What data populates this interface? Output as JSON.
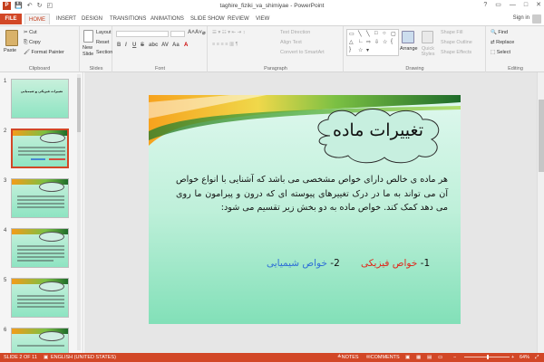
{
  "window": {
    "title": "taghire_fiziki_va_shimiyae - PowerPoint",
    "app_icon_letter": "P"
  },
  "qat": {
    "save": "💾",
    "undo": "↶",
    "redo": "↻",
    "start": "◰"
  },
  "win_controls": {
    "help": "?",
    "restore": "▭",
    "minimize": "—",
    "maximize": "□",
    "close": "✕"
  },
  "tabs": [
    "FILE",
    "HOME",
    "INSERT",
    "DESIGN",
    "TRANSITIONS",
    "ANIMATIONS",
    "SLIDE SHOW",
    "REVIEW",
    "VIEW"
  ],
  "active_tab": "HOME",
  "account": {
    "signin": "Sign in"
  },
  "ribbon": {
    "clipboard": {
      "label": "Clipboard",
      "paste": "Paste",
      "cut": "Cut",
      "copy": "Copy",
      "format_painter": "Format Painter"
    },
    "slides": {
      "label": "Slides",
      "new_slide": "New",
      "new_slide2": "Slide",
      "layout": "Layout",
      "reset": "Reset",
      "section": "Section"
    },
    "font": {
      "label": "Font",
      "bold": "B",
      "italic": "I",
      "underline": "U",
      "strike": "S",
      "shadow": "abc",
      "spacing": "AV",
      "case": "Aa",
      "color": "A",
      "grow": "A˄",
      "shrink": "A˅",
      "clear": "⌀"
    },
    "paragraph": {
      "label": "Paragraph",
      "text_direction": "Text Direction",
      "align_text": "Align Text",
      "convert_smartart": "Convert to SmartArt"
    },
    "drawing": {
      "label": "Drawing",
      "arrange": "Arrange",
      "quick_styles": "Quick Styles",
      "shape_fill": "Shape Fill",
      "shape_outline": "Shape Outline",
      "shape_effects": "Shape Effects"
    },
    "editing": {
      "label": "Editing",
      "find": "Find",
      "replace": "Replace",
      "select": "Select"
    }
  },
  "thumbnails": [
    {
      "num": "1",
      "title": "تغییرات فیزیکی و شیمیایی"
    },
    {
      "num": "2"
    },
    {
      "num": "3"
    },
    {
      "num": "4"
    },
    {
      "num": "5"
    },
    {
      "num": "6"
    }
  ],
  "slide": {
    "title": "تغییرات ماده",
    "body": "هر ماده ی خالص دارای خواص مشخصی می باشد که آشنایی با انواع خواص آن می تواند به ما در درک تغییرهای پیوسته ای که درون و پیرامون ما روی می دهد کمک کند. خواص ماده به دو بخش زیر تقسیم می شود:",
    "item1_num": "1-",
    "item1_text": "خواص فیزیکی",
    "item2_num": "2-",
    "item2_text": "خواص شیمیایی",
    "item1_color": "#e0271b",
    "item2_color": "#2f6fd6"
  },
  "status": {
    "slide_info": "SLIDE 2 OF 11",
    "language": "ENGLISH (UNITED STATES)",
    "notes": "NOTES",
    "comments": "COMMENTS",
    "zoom": "64%"
  },
  "colors": {
    "accent": "#d24726",
    "slide_bg": "#bff0da"
  }
}
